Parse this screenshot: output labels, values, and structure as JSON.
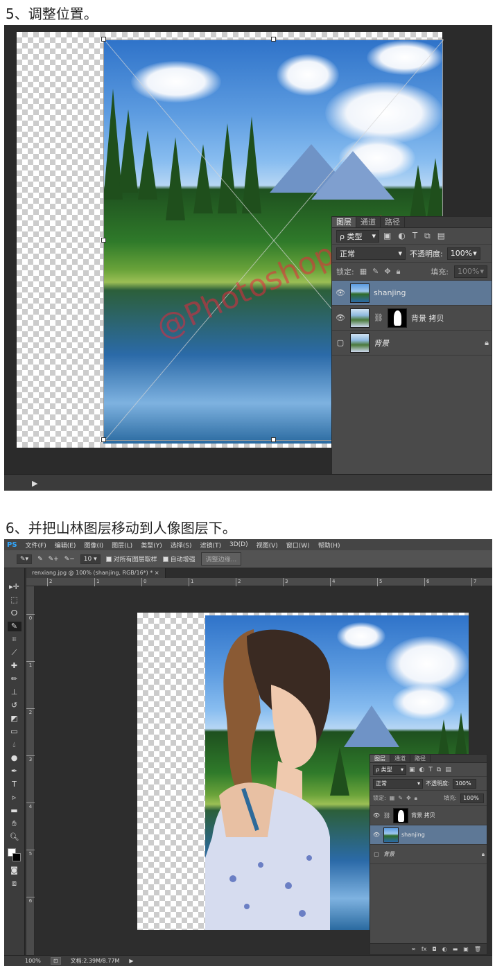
{
  "steps": {
    "step5_title": "5、调整位置。",
    "step6_title": "6、并把山林图层移动到人像图层下。"
  },
  "watermark": "@Photoshop大师",
  "screen1": {
    "layers_panel": {
      "tabs": [
        "图层",
        "通道",
        "路径"
      ],
      "filter_label": "ρ 类型",
      "blend_mode": "正常",
      "opacity_label": "不透明度:",
      "opacity_value": "100%",
      "lock_label": "锁定:",
      "fill_label": "填充:",
      "fill_value": "100%",
      "layers": [
        {
          "name": "shanjing",
          "visible": true,
          "active": true
        },
        {
          "name": "背景 拷贝",
          "visible": true,
          "active": false
        },
        {
          "name": "背景",
          "visible": false,
          "active": false
        }
      ]
    }
  },
  "screen2": {
    "app_logo": "PS",
    "menu": [
      "文件(F)",
      "编辑(E)",
      "图像(I)",
      "图层(L)",
      "类型(Y)",
      "选择(S)",
      "滤镜(T)",
      "3D(D)",
      "视图(V)",
      "窗口(W)",
      "帮助(H)"
    ],
    "options": {
      "brush_size": "10",
      "sample_all_layers": "对所有图层取样",
      "auto_enhance": "自动增强",
      "refine_edge": "调整边缘..."
    },
    "document_tab": "renxiang.jpg @ 100% (shanjing, RGB/16*) *",
    "ruler_h_ticks": [
      "2",
      "1",
      "0",
      "1",
      "2",
      "3",
      "4",
      "5",
      "6",
      "7"
    ],
    "ruler_v_ticks": [
      "0",
      "1",
      "2",
      "3",
      "4",
      "5",
      "6"
    ],
    "layers_panel": {
      "tabs": [
        "图层",
        "通道",
        "路径"
      ],
      "filter_label": "ρ 类型",
      "blend_mode": "正常",
      "opacity_label": "不透明度:",
      "opacity_value": "100%",
      "lock_label": "锁定:",
      "fill_label": "填充:",
      "fill_value": "100%",
      "layers": [
        {
          "name": "背景 拷贝",
          "visible": true,
          "active": false
        },
        {
          "name": "shanjing",
          "visible": true,
          "active": true
        },
        {
          "name": "背景",
          "visible": false,
          "active": false
        }
      ]
    },
    "status": {
      "zoom": "100%",
      "doc_info": "文档:2.39M/8.77M"
    }
  }
}
